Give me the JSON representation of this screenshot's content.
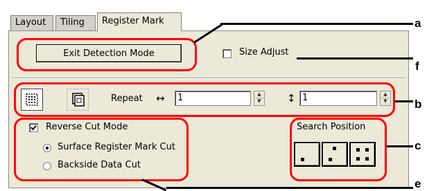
{
  "tabs": [
    "Layout",
    "Tiling",
    "Register Mark"
  ],
  "exit_button": "Exit Detection Mode",
  "size_adjust": {
    "label": "Size Adjust",
    "checked": false
  },
  "repeat": {
    "label": "Repeat",
    "horizontal_symbol": "↔",
    "vertical_symbol": "↕",
    "horizontal_value": "1",
    "vertical_value": "1"
  },
  "reverse_cut": {
    "label": "Reverse Cut Mode",
    "checked": true
  },
  "cut_options": [
    "Surface Register Mark Cut",
    "Backside Data Cut"
  ],
  "selected_cut_option": 0,
  "search_position": {
    "label": "Search Position"
  },
  "callouts": [
    "a",
    "f",
    "b",
    "c",
    "e"
  ],
  "colors": {
    "callout": "#ff0000",
    "panel": "#ece9d8"
  }
}
